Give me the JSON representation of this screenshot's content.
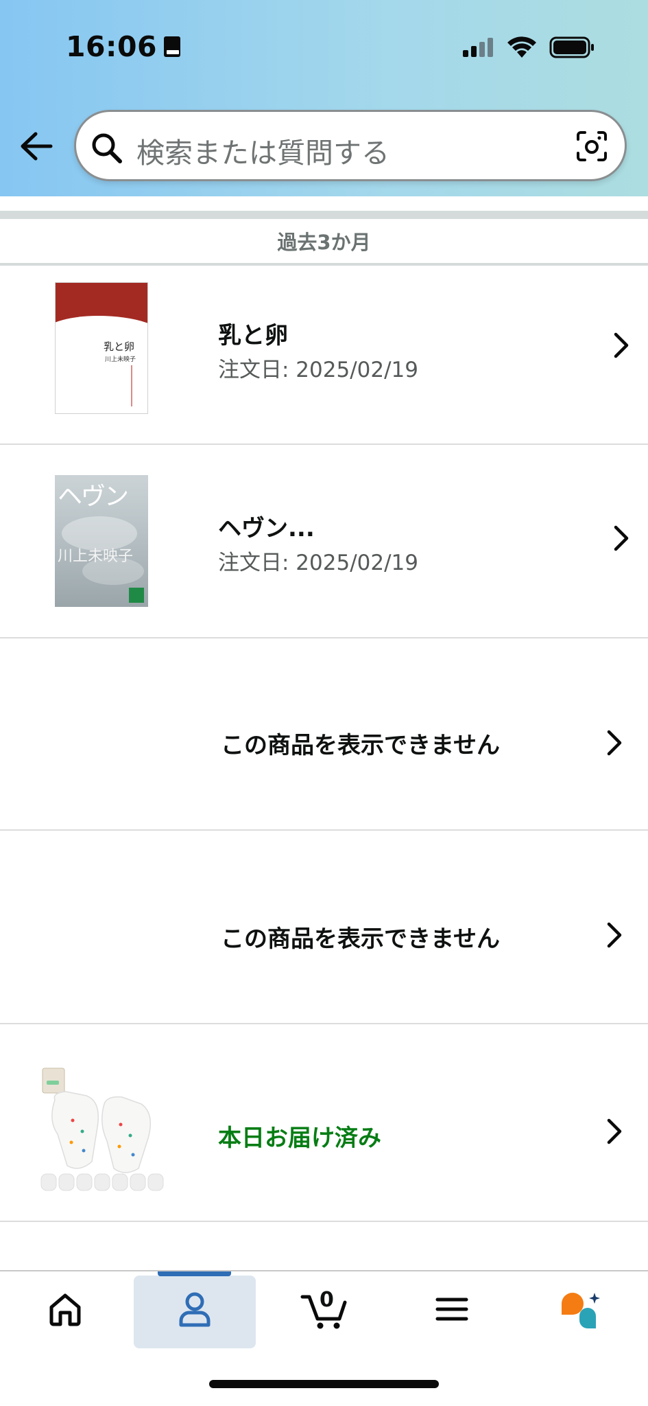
{
  "status_bar": {
    "time": "16:06"
  },
  "header": {
    "search_placeholder": "検索または質問する"
  },
  "section": {
    "label": "過去3か月"
  },
  "orders": [
    {
      "title": "乳と卵",
      "date": "注文日: 2025/02/19"
    },
    {
      "title": "ヘヴン...",
      "date": "注文日: 2025/02/19"
    },
    {
      "title": "この商品を表示できません"
    },
    {
      "title": "この商品を表示できません"
    },
    {
      "status": "本日お届け済み"
    }
  ],
  "covers": {
    "book1_title": "乳と卵",
    "book1_author": "川上未映子",
    "book2_title": "ヘヴン",
    "book2_author": "川上未映子"
  },
  "bottom_nav": {
    "cart_count": "0",
    "items": [
      "home-icon",
      "account-icon",
      "cart-icon",
      "menu-icon",
      "rufus-icon"
    ],
    "active": "account-icon"
  },
  "colors": {
    "delivered_green": "#067d14",
    "active_nav_bar": "#2f6db5",
    "active_nav_bg": "#dde6ef"
  }
}
